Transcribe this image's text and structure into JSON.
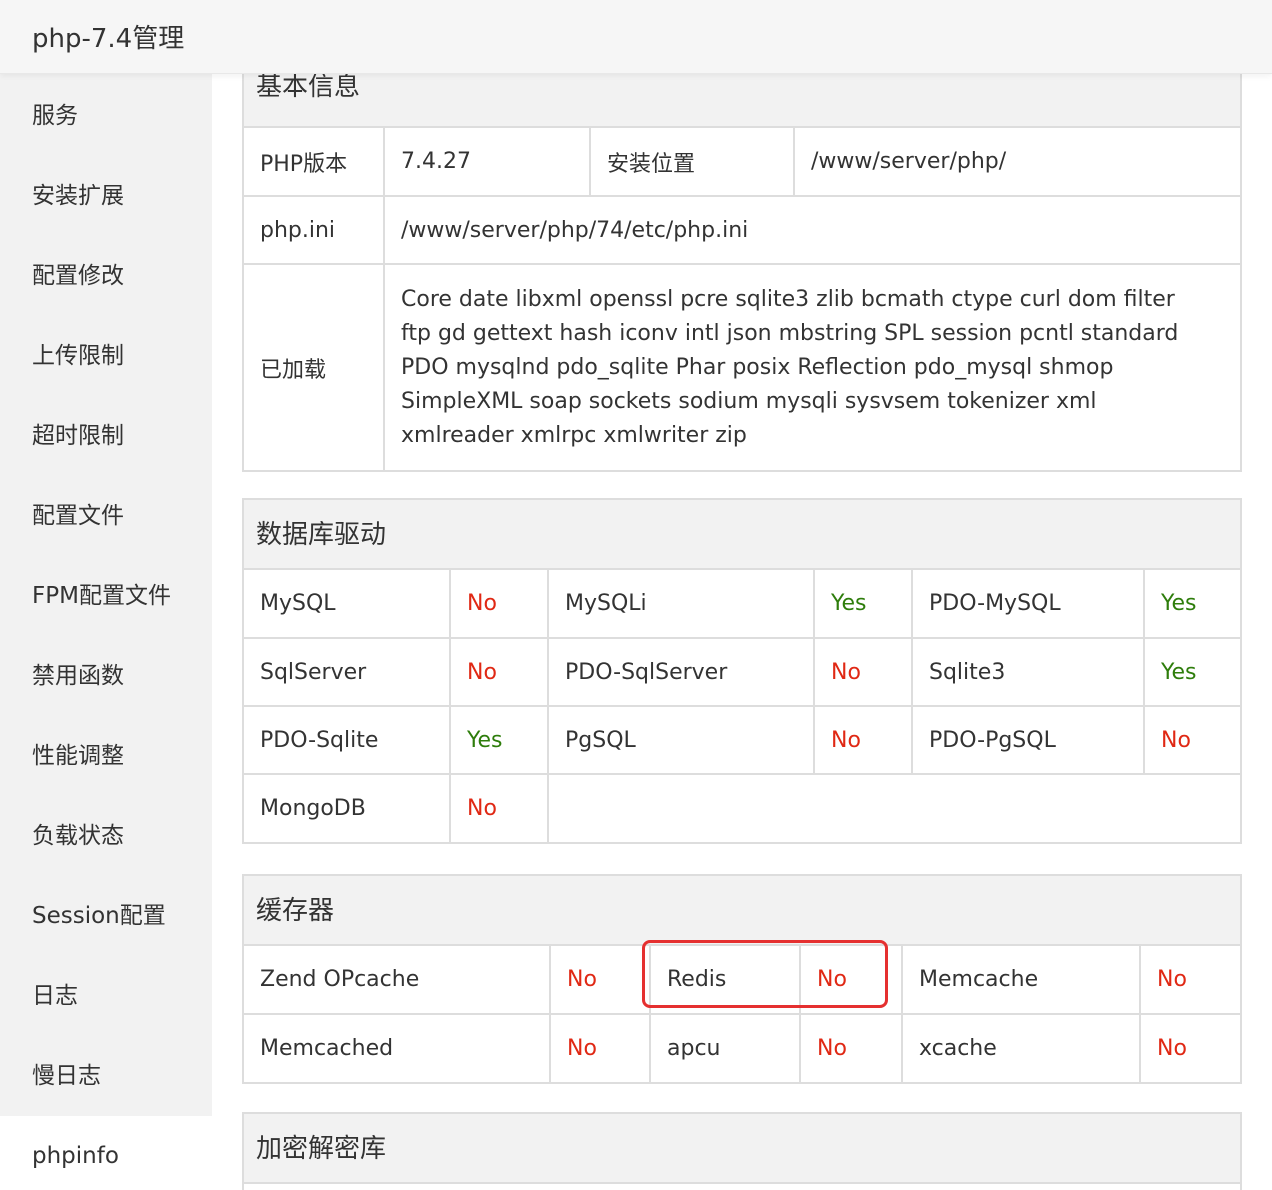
{
  "header": {
    "title": "php-7.4管理"
  },
  "sidebar": {
    "items": [
      {
        "label": "服务"
      },
      {
        "label": "安装扩展"
      },
      {
        "label": "配置修改"
      },
      {
        "label": "上传限制"
      },
      {
        "label": "超时限制"
      },
      {
        "label": "配置文件"
      },
      {
        "label": "FPM配置文件"
      },
      {
        "label": "禁用函数"
      },
      {
        "label": "性能调整"
      },
      {
        "label": "负载状态"
      },
      {
        "label": "Session配置"
      },
      {
        "label": "日志"
      },
      {
        "label": "慢日志"
      },
      {
        "label": "phpinfo"
      }
    ],
    "active": "phpinfo"
  },
  "basic": {
    "title": "基本信息",
    "php_version_label": "PHP版本",
    "php_version": "7.4.27",
    "install_path_label": "安装位置",
    "install_path": "/www/server/php/",
    "ini_label": "php.ini",
    "ini_path": "/www/server/php/74/etc/php.ini",
    "loaded_label": "已加载",
    "loaded": "Core date libxml openssl pcre sqlite3 zlib bcmath ctype curl dom filter ftp gd gettext hash iconv intl json mbstring SPL session pcntl standard PDO mysqlnd pdo_sqlite Phar posix Reflection pdo_mysql shmop SimpleXML soap sockets sodium mysqli sysvsem tokenizer xml xmlreader xmlrpc xmlwriter zip"
  },
  "db": {
    "title": "数据库驱动",
    "rows": [
      [
        {
          "name": "MySQL",
          "status": "No"
        },
        {
          "name": "MySQLi",
          "status": "Yes"
        },
        {
          "name": "PDO-MySQL",
          "status": "Yes"
        }
      ],
      [
        {
          "name": "SqlServer",
          "status": "No"
        },
        {
          "name": "PDO-SqlServer",
          "status": "No"
        },
        {
          "name": "Sqlite3",
          "status": "Yes"
        }
      ],
      [
        {
          "name": "PDO-Sqlite",
          "status": "Yes"
        },
        {
          "name": "PgSQL",
          "status": "No"
        },
        {
          "name": "PDO-PgSQL",
          "status": "No"
        }
      ],
      [
        {
          "name": "MongoDB",
          "status": "No"
        }
      ]
    ]
  },
  "cache": {
    "title": "缓存器",
    "rows": [
      [
        {
          "name": "Zend OPcache",
          "status": "No"
        },
        {
          "name": "Redis",
          "status": "No"
        },
        {
          "name": "Memcache",
          "status": "No"
        }
      ],
      [
        {
          "name": "Memcached",
          "status": "No"
        },
        {
          "name": "apcu",
          "status": "No"
        },
        {
          "name": "xcache",
          "status": "No"
        }
      ]
    ]
  },
  "crypto": {
    "title": "加密解密库"
  },
  "colors": {
    "yes": "#2e7d0b",
    "no": "#e02814",
    "highlight": "#e53030"
  }
}
